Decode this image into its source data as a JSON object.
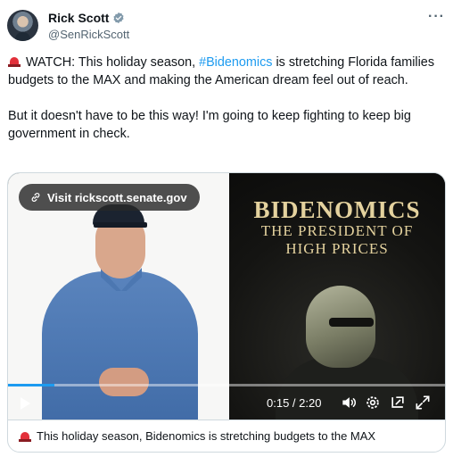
{
  "author": {
    "display_name": "Rick Scott",
    "handle": "@SenRickScott",
    "verified_icon": "verified-badge-icon"
  },
  "more_menu": "···",
  "tweet": {
    "line1_prefix": "WATCH: This holiday season, ",
    "hashtag": "#Bidenomics",
    "line1_suffix": " is stretching Florida families budgets to the MAX and making the American dream feel out of reach.",
    "paragraph2": "But it doesn't have to be this way! I'm going to keep fighting to keep big government in check."
  },
  "video": {
    "link_chip": "Visit rickscott.senate.gov",
    "poster_title": "BIDENOMICS",
    "poster_subtitle_1": "THE PRESIDENT OF",
    "poster_subtitle_2": "HIGH PRICES",
    "time": "0:15 / 2:20",
    "progress_fraction": 0.107
  },
  "caption": "This holiday season, Bidenomics is stretching budgets to the MAX",
  "colors": {
    "accent": "#1d9bf0",
    "poster_gold": "#e4d29e",
    "siren_red": "#e2303a"
  }
}
